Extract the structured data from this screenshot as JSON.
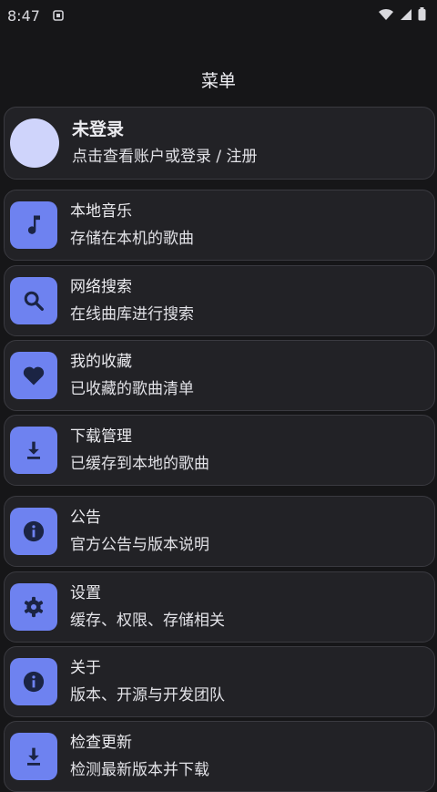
{
  "status_bar": {
    "time": "8:47"
  },
  "header": {
    "title": "菜单"
  },
  "profile": {
    "title": "未登录",
    "subtitle": "点击查看账户或登录 / 注册"
  },
  "menu": [
    {
      "title": "本地音乐",
      "subtitle": "存储在本机的歌曲",
      "icon": "music-note-icon"
    },
    {
      "title": "网络搜索",
      "subtitle": "在线曲库进行搜索",
      "icon": "search-icon"
    },
    {
      "title": "我的收藏",
      "subtitle": "已收藏的歌曲清单",
      "icon": "heart-icon"
    },
    {
      "title": "下载管理",
      "subtitle": "已缓存到本地的歌曲",
      "icon": "download-icon"
    },
    {
      "title": "公告",
      "subtitle": "官方公告与版本说明",
      "icon": "info-icon"
    },
    {
      "title": "设置",
      "subtitle": "缓存、权限、存储相关",
      "icon": "gear-icon"
    },
    {
      "title": "关于",
      "subtitle": "版本、开源与开发团队",
      "icon": "info-icon"
    },
    {
      "title": "检查更新",
      "subtitle": "检测最新版本并下载",
      "icon": "download-icon"
    }
  ],
  "colors": {
    "background": "#161618",
    "card": "#222226",
    "accent": "#6e82f0",
    "icon_glyph": "#1b2444",
    "avatar": "#cfd4fb"
  }
}
